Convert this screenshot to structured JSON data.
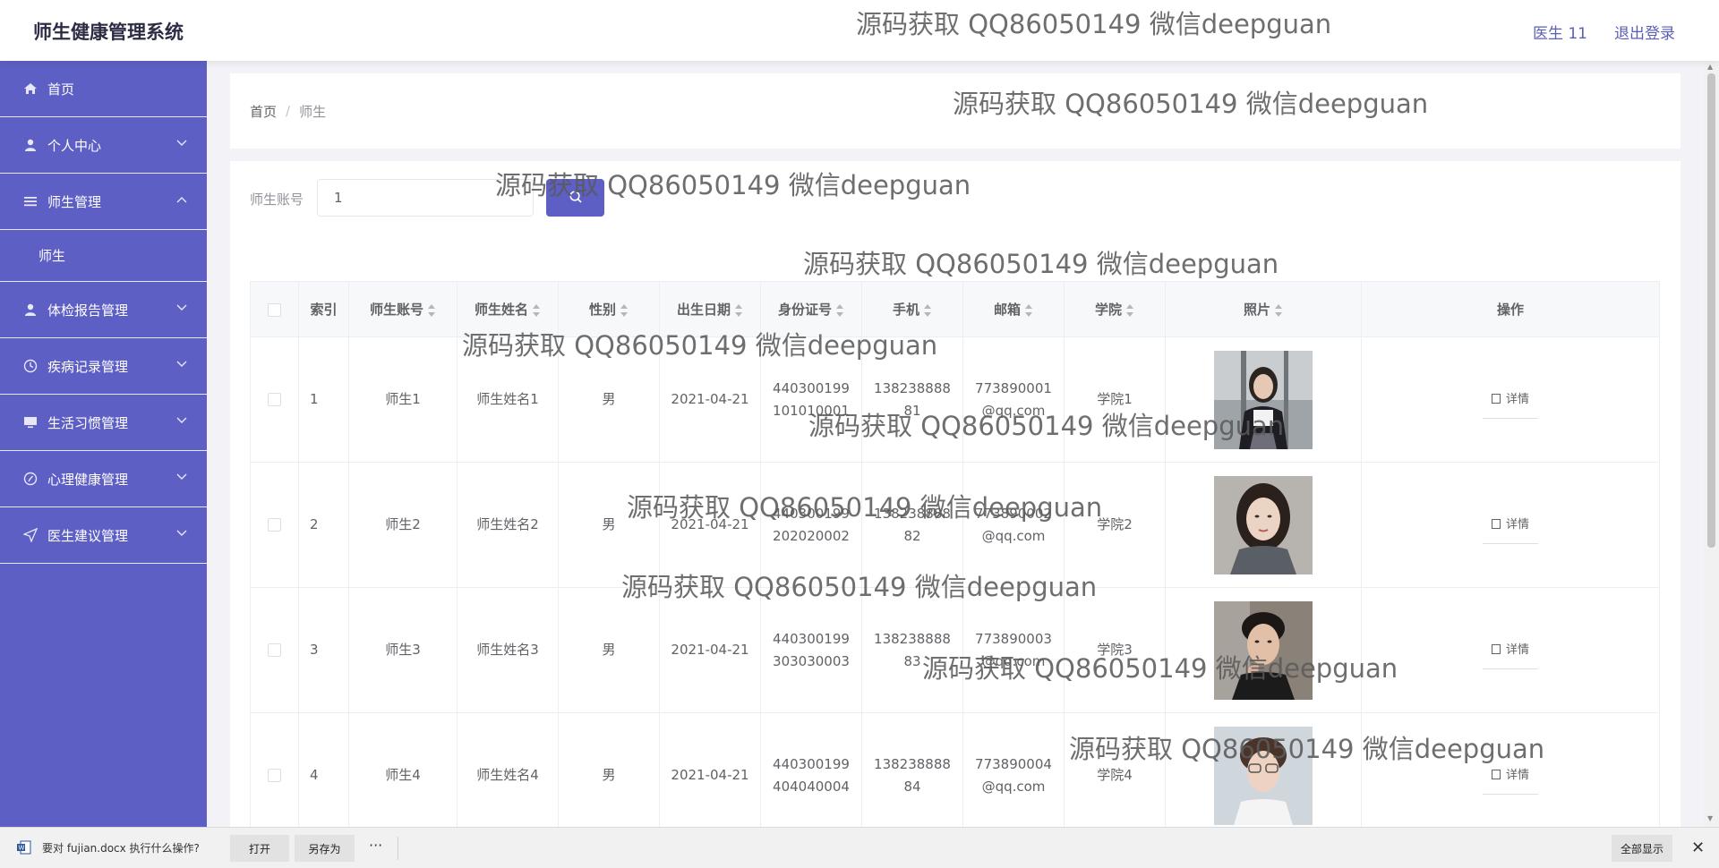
{
  "header": {
    "title": "师生健康管理系统",
    "user": "医生 11",
    "logout": "退出登录"
  },
  "sidebar": {
    "items": [
      {
        "label": "首页",
        "icon": "home-icon"
      },
      {
        "label": "个人中心",
        "icon": "user-icon"
      },
      {
        "label": "师生管理",
        "icon": "list-icon",
        "expanded": true,
        "children": [
          "师生"
        ]
      },
      {
        "label": "体检报告管理",
        "icon": "user-icon"
      },
      {
        "label": "疾病记录管理",
        "icon": "clock-icon"
      },
      {
        "label": "生活习惯管理",
        "icon": "monitor-icon"
      },
      {
        "label": "心理健康管理",
        "icon": "compass-icon"
      },
      {
        "label": "医生建议管理",
        "icon": "send-icon"
      }
    ]
  },
  "breadcrumb": {
    "home": "首页",
    "sep": "/",
    "current": "师生"
  },
  "search": {
    "label": "师生账号",
    "value": "1"
  },
  "table": {
    "headers": [
      "索引",
      "师生账号",
      "师生姓名",
      "性别",
      "出生日期",
      "身份证号",
      "手机",
      "邮箱",
      "学院",
      "照片",
      "操作"
    ],
    "rows": [
      {
        "index": "1",
        "account": "师生1",
        "name": "师生姓名1",
        "gender": "男",
        "birth": "2021-04-21",
        "id1": "440300199",
        "id2": "101010001",
        "phone1": "138238888",
        "phone2": "81",
        "email1": "773890001",
        "email2": "@qq.com",
        "college": "学院1"
      },
      {
        "index": "2",
        "account": "师生2",
        "name": "师生姓名2",
        "gender": "男",
        "birth": "2021-04-21",
        "id1": "440300199",
        "id2": "202020002",
        "phone1": "138238888",
        "phone2": "82",
        "email1": "773890002",
        "email2": "@qq.com",
        "college": "学院2"
      },
      {
        "index": "3",
        "account": "师生3",
        "name": "师生姓名3",
        "gender": "男",
        "birth": "2021-04-21",
        "id1": "440300199",
        "id2": "303030003",
        "phone1": "138238888",
        "phone2": "83",
        "email1": "773890003",
        "email2": "@qq.com",
        "college": "学院3"
      },
      {
        "index": "4",
        "account": "师生4",
        "name": "师生姓名4",
        "gender": "男",
        "birth": "2021-04-21",
        "id1": "440300199",
        "id2": "404040004",
        "phone1": "138238888",
        "phone2": "84",
        "email1": "773890004",
        "email2": "@qq.com",
        "college": "学院4"
      }
    ],
    "detail_label": "详情"
  },
  "download_bar": {
    "file_text": "要对 fujian.docx 执行什么操作?",
    "open": "打开",
    "save_as": "另存为",
    "more": "···",
    "show_all": "全部显示",
    "close": "✕"
  },
  "watermark": "源码获取 QQ86050149 微信deepguan",
  "colors": {
    "primary": "#5e5fc4",
    "header_text": "#5b5fb3"
  }
}
